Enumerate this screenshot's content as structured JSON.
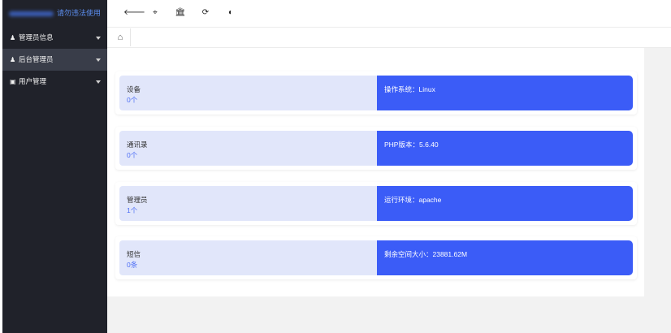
{
  "sidebar": {
    "brand_text": "请勿违法使用",
    "items": [
      {
        "label": "管理员信息",
        "icon": "user-icon"
      },
      {
        "label": "后台管理员",
        "icon": "user-icon"
      },
      {
        "label": "用户管理",
        "icon": "id-card-icon"
      }
    ]
  },
  "toolbar": {
    "back": "🡐",
    "fullscreen": "⌖",
    "bank": "🏛",
    "refresh": "⟳",
    "theme": "◐"
  },
  "tabs": {
    "home": "⌂"
  },
  "stats": [
    {
      "title": "设备",
      "count": "0个",
      "info": "操作系统：Linux"
    },
    {
      "title": "通讯录",
      "count": "0个",
      "info": "PHP版本：5.6.40"
    },
    {
      "title": "管理员",
      "count": "1个",
      "info": "运行环境：apache"
    },
    {
      "title": "短信",
      "count": "0条",
      "info": "剩余空间大小：23881.62M"
    }
  ],
  "colors": {
    "sidebar_bg": "#20222a",
    "sidebar_active": "#393d49",
    "card_light": "#e1e6fa",
    "card_accent": "#3b5cf7",
    "count_text": "#4d6ef5"
  }
}
